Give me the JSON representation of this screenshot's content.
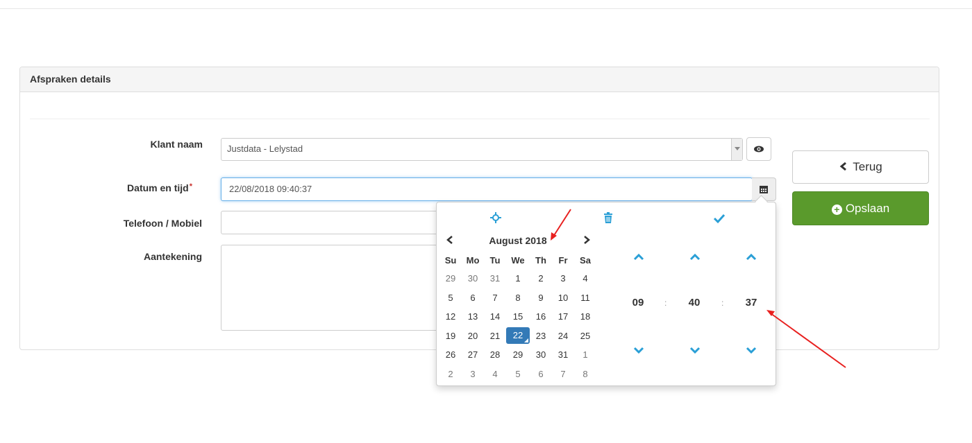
{
  "panel": {
    "title": "Afspraken details"
  },
  "form": {
    "client": {
      "label": "Klant naam",
      "value": "Justdata - Lelystad"
    },
    "datetime": {
      "label": "Datum en tijd",
      "required_mark": "*",
      "value": "22/08/2018 09:40:37"
    },
    "phone": {
      "label": "Telefoon / Mobiel",
      "value": ""
    },
    "notes": {
      "label": "Aantekening",
      "value": ""
    }
  },
  "buttons": {
    "back": "Terug",
    "save": "Opslaan"
  },
  "datepicker": {
    "month_title": "August 2018",
    "weekdays": [
      "Su",
      "Mo",
      "Tu",
      "We",
      "Th",
      "Fr",
      "Sa"
    ],
    "weeks": [
      [
        "29",
        "30",
        "31",
        "1",
        "2",
        "3",
        "4"
      ],
      [
        "5",
        "6",
        "7",
        "8",
        "9",
        "10",
        "11"
      ],
      [
        "12",
        "13",
        "14",
        "15",
        "16",
        "17",
        "18"
      ],
      [
        "19",
        "20",
        "21",
        "22",
        "23",
        "24",
        "25"
      ],
      [
        "26",
        "27",
        "28",
        "29",
        "30",
        "31",
        "1"
      ],
      [
        "2",
        "3",
        "4",
        "5",
        "6",
        "7",
        "8"
      ]
    ],
    "selected_day": "22",
    "time": {
      "hour": "09",
      "minute": "40",
      "second": "37",
      "separator": ":"
    }
  },
  "colors": {
    "accent": "#2a9fd6",
    "primary": "#337ab7",
    "save": "#5a9a2c",
    "annotation": "#e8201f"
  },
  "icons": [
    "eye-icon",
    "calendar-icon",
    "chevron-left-icon",
    "plus-circle-icon",
    "crosshair-icon",
    "trash-icon",
    "check-icon",
    "chevron-up-icon",
    "chevron-down-icon"
  ]
}
